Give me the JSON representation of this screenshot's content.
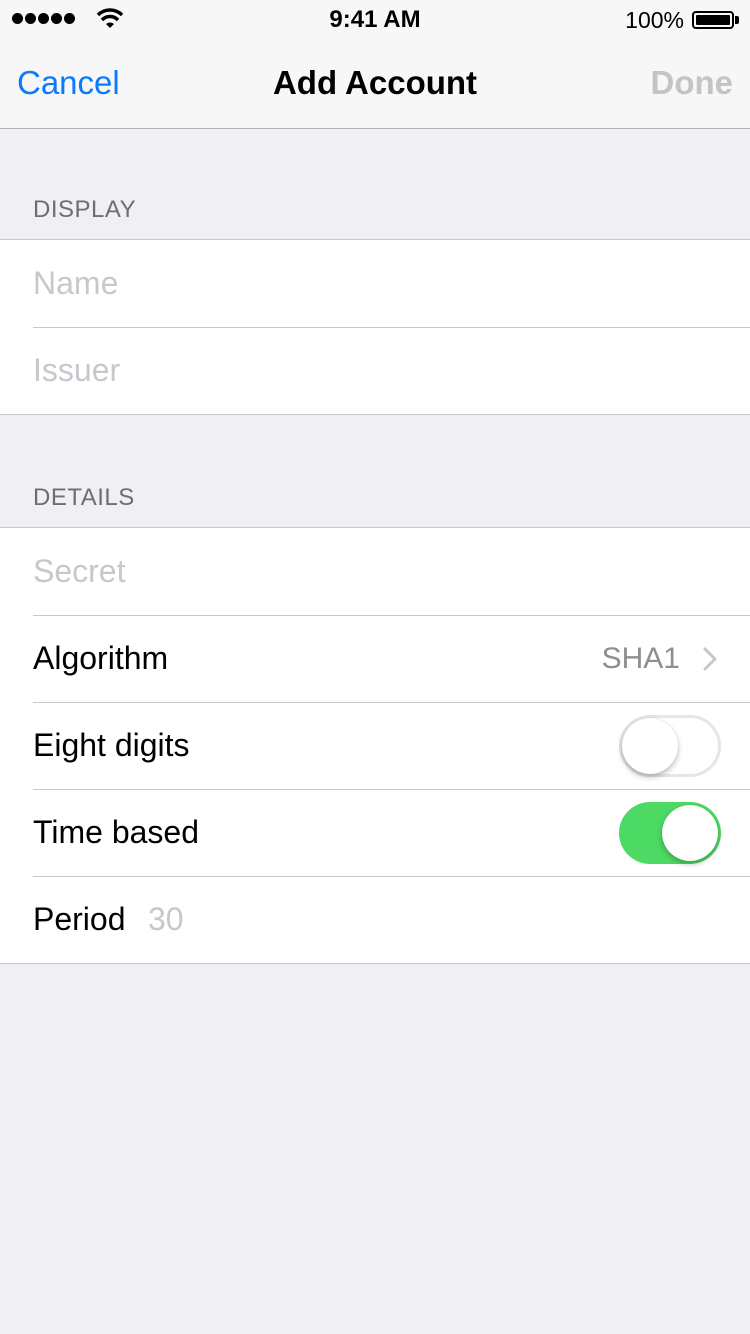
{
  "status_bar": {
    "time": "9:41 AM",
    "battery": "100%"
  },
  "nav": {
    "cancel": "Cancel",
    "title": "Add Account",
    "done": "Done"
  },
  "display_section": {
    "header": "DISPLAY",
    "name_placeholder": "Name",
    "name_value": "",
    "issuer_placeholder": "Issuer",
    "issuer_value": ""
  },
  "details_section": {
    "header": "DETAILS",
    "secret_placeholder": "Secret",
    "secret_value": "",
    "algorithm_label": "Algorithm",
    "algorithm_value": "SHA1",
    "eight_digits_label": "Eight digits",
    "eight_digits_on": false,
    "time_based_label": "Time based",
    "time_based_on": true,
    "period_label": "Period",
    "period_placeholder": "30",
    "period_value": ""
  },
  "colors": {
    "accent": "#0a7aff",
    "toggle_on": "#4cd964",
    "background": "#efeff4"
  }
}
